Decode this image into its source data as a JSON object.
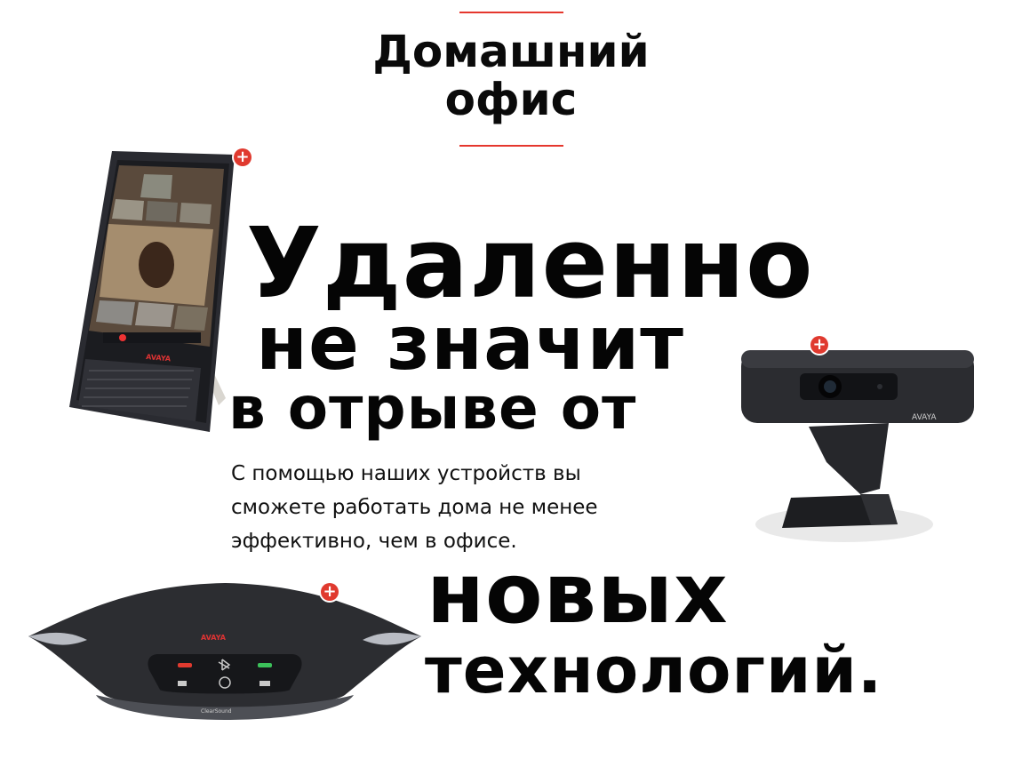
{
  "header": {
    "title_line1": "Домашний",
    "title_line2": "офис",
    "accent_color": "#e5372d"
  },
  "headline": {
    "line1": "Удаленно",
    "line2": "не значит",
    "line3": "в отрыве от",
    "line4": "новых",
    "line5": "технологий."
  },
  "description": {
    "line1": "С помощью наших устройств вы",
    "line2": "сможете работать дома не менее",
    "line3": "эффективно, чем в офисе."
  },
  "products": {
    "tablet_brand": "AVAYA",
    "camera_brand": "AVAYA",
    "speaker_brand": "AVAYA",
    "speaker_sub": "ClearSound",
    "plus_glyph": "+"
  },
  "icons": [
    "plus-icon",
    "phone-hangup-icon",
    "bluetooth-icon",
    "phone-answer-icon",
    "volume-down-icon",
    "mute-icon",
    "volume-up-icon"
  ]
}
